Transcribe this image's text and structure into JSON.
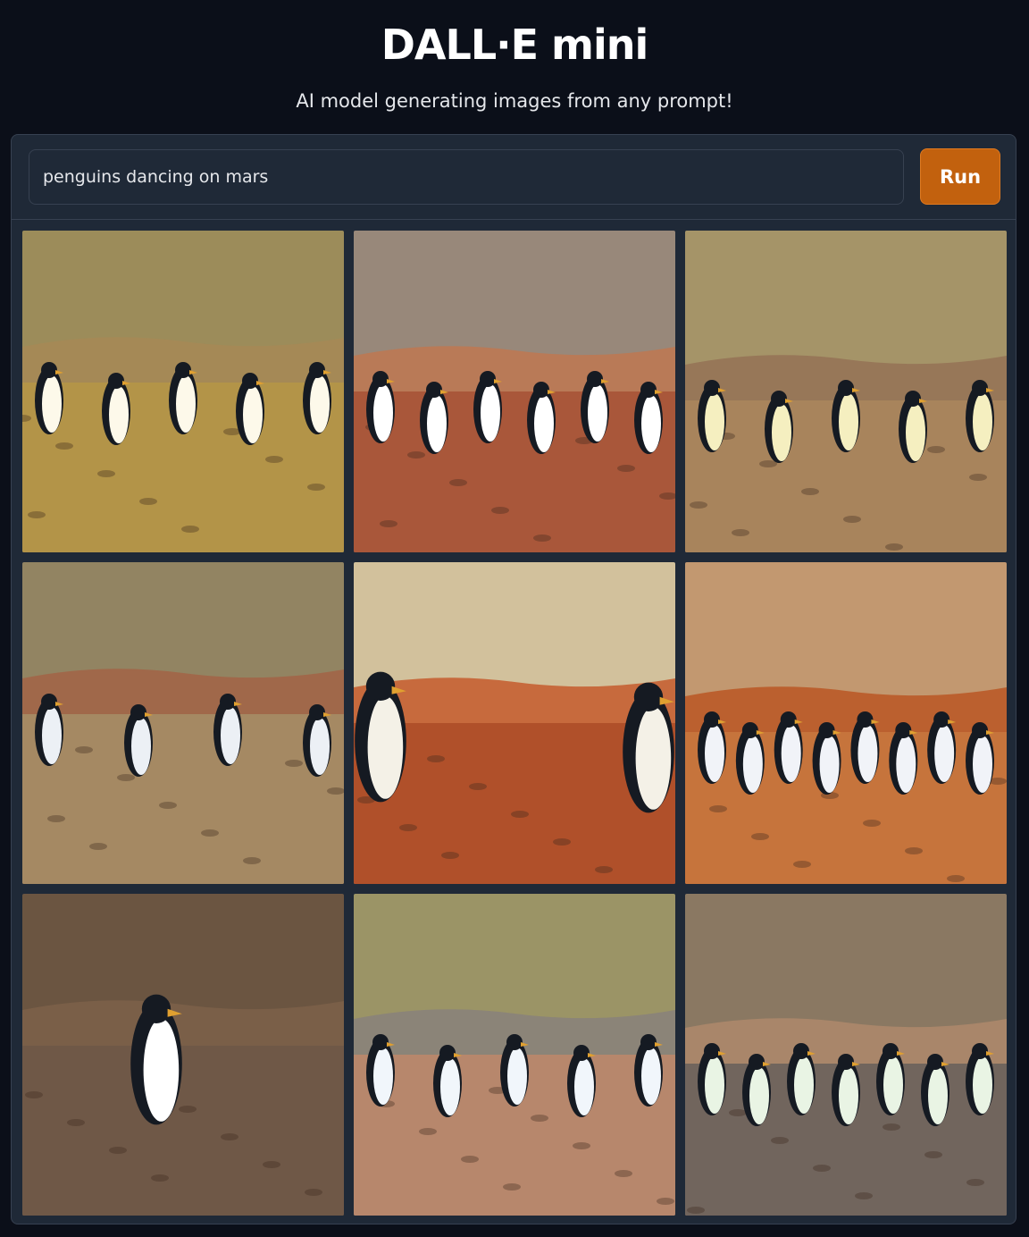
{
  "app": {
    "title": "DALL·E mini",
    "subtitle": "AI model generating images from any prompt!"
  },
  "prompt": {
    "value": "penguins dancing on mars"
  },
  "run_button": {
    "label": "Run"
  },
  "gallery": {
    "images": [
      {
        "sky": "#9c8c5a",
        "ground": "#b39448",
        "ridge": "#a58956",
        "penguins": 5,
        "penguin_body": "#fdf9ea"
      },
      {
        "sky": "#98887a",
        "ground": "#a9573a",
        "ridge": "#b97a57",
        "penguins": 6,
        "penguin_body": "#ffffff"
      },
      {
        "sky": "#a59468",
        "ground": "#a8845c",
        "ridge": "#977758",
        "penguins": 5,
        "penguin_body": "#f5efc0"
      },
      {
        "sky": "#928462",
        "ground": "#a58963",
        "ridge": "#a0684a",
        "penguins": 4,
        "penguin_body": "#ecf0f5"
      },
      {
        "sky": "#d2c19c",
        "ground": "#b0502a",
        "ridge": "#c76a3d",
        "penguins": 2,
        "penguin_body": "#f4f1e7"
      },
      {
        "sky": "#c29870",
        "ground": "#c6743c",
        "ridge": "#bb602f",
        "penguins": 8,
        "penguin_body": "#f1f3f8"
      },
      {
        "sky": "#6b5541",
        "ground": "#6f5847",
        "ridge": "#7a5f48",
        "penguins": 1,
        "penguin_body": "#ffffff"
      },
      {
        "sky": "#9b9466",
        "ground": "#b7876c",
        "ridge": "#8b8478",
        "penguins": 5,
        "penguin_body": "#f1f6fb"
      },
      {
        "sky": "#8a7862",
        "ground": "#71655d",
        "ridge": "#a9866a",
        "penguins": 7,
        "penguin_body": "#e9f4e4"
      }
    ]
  }
}
